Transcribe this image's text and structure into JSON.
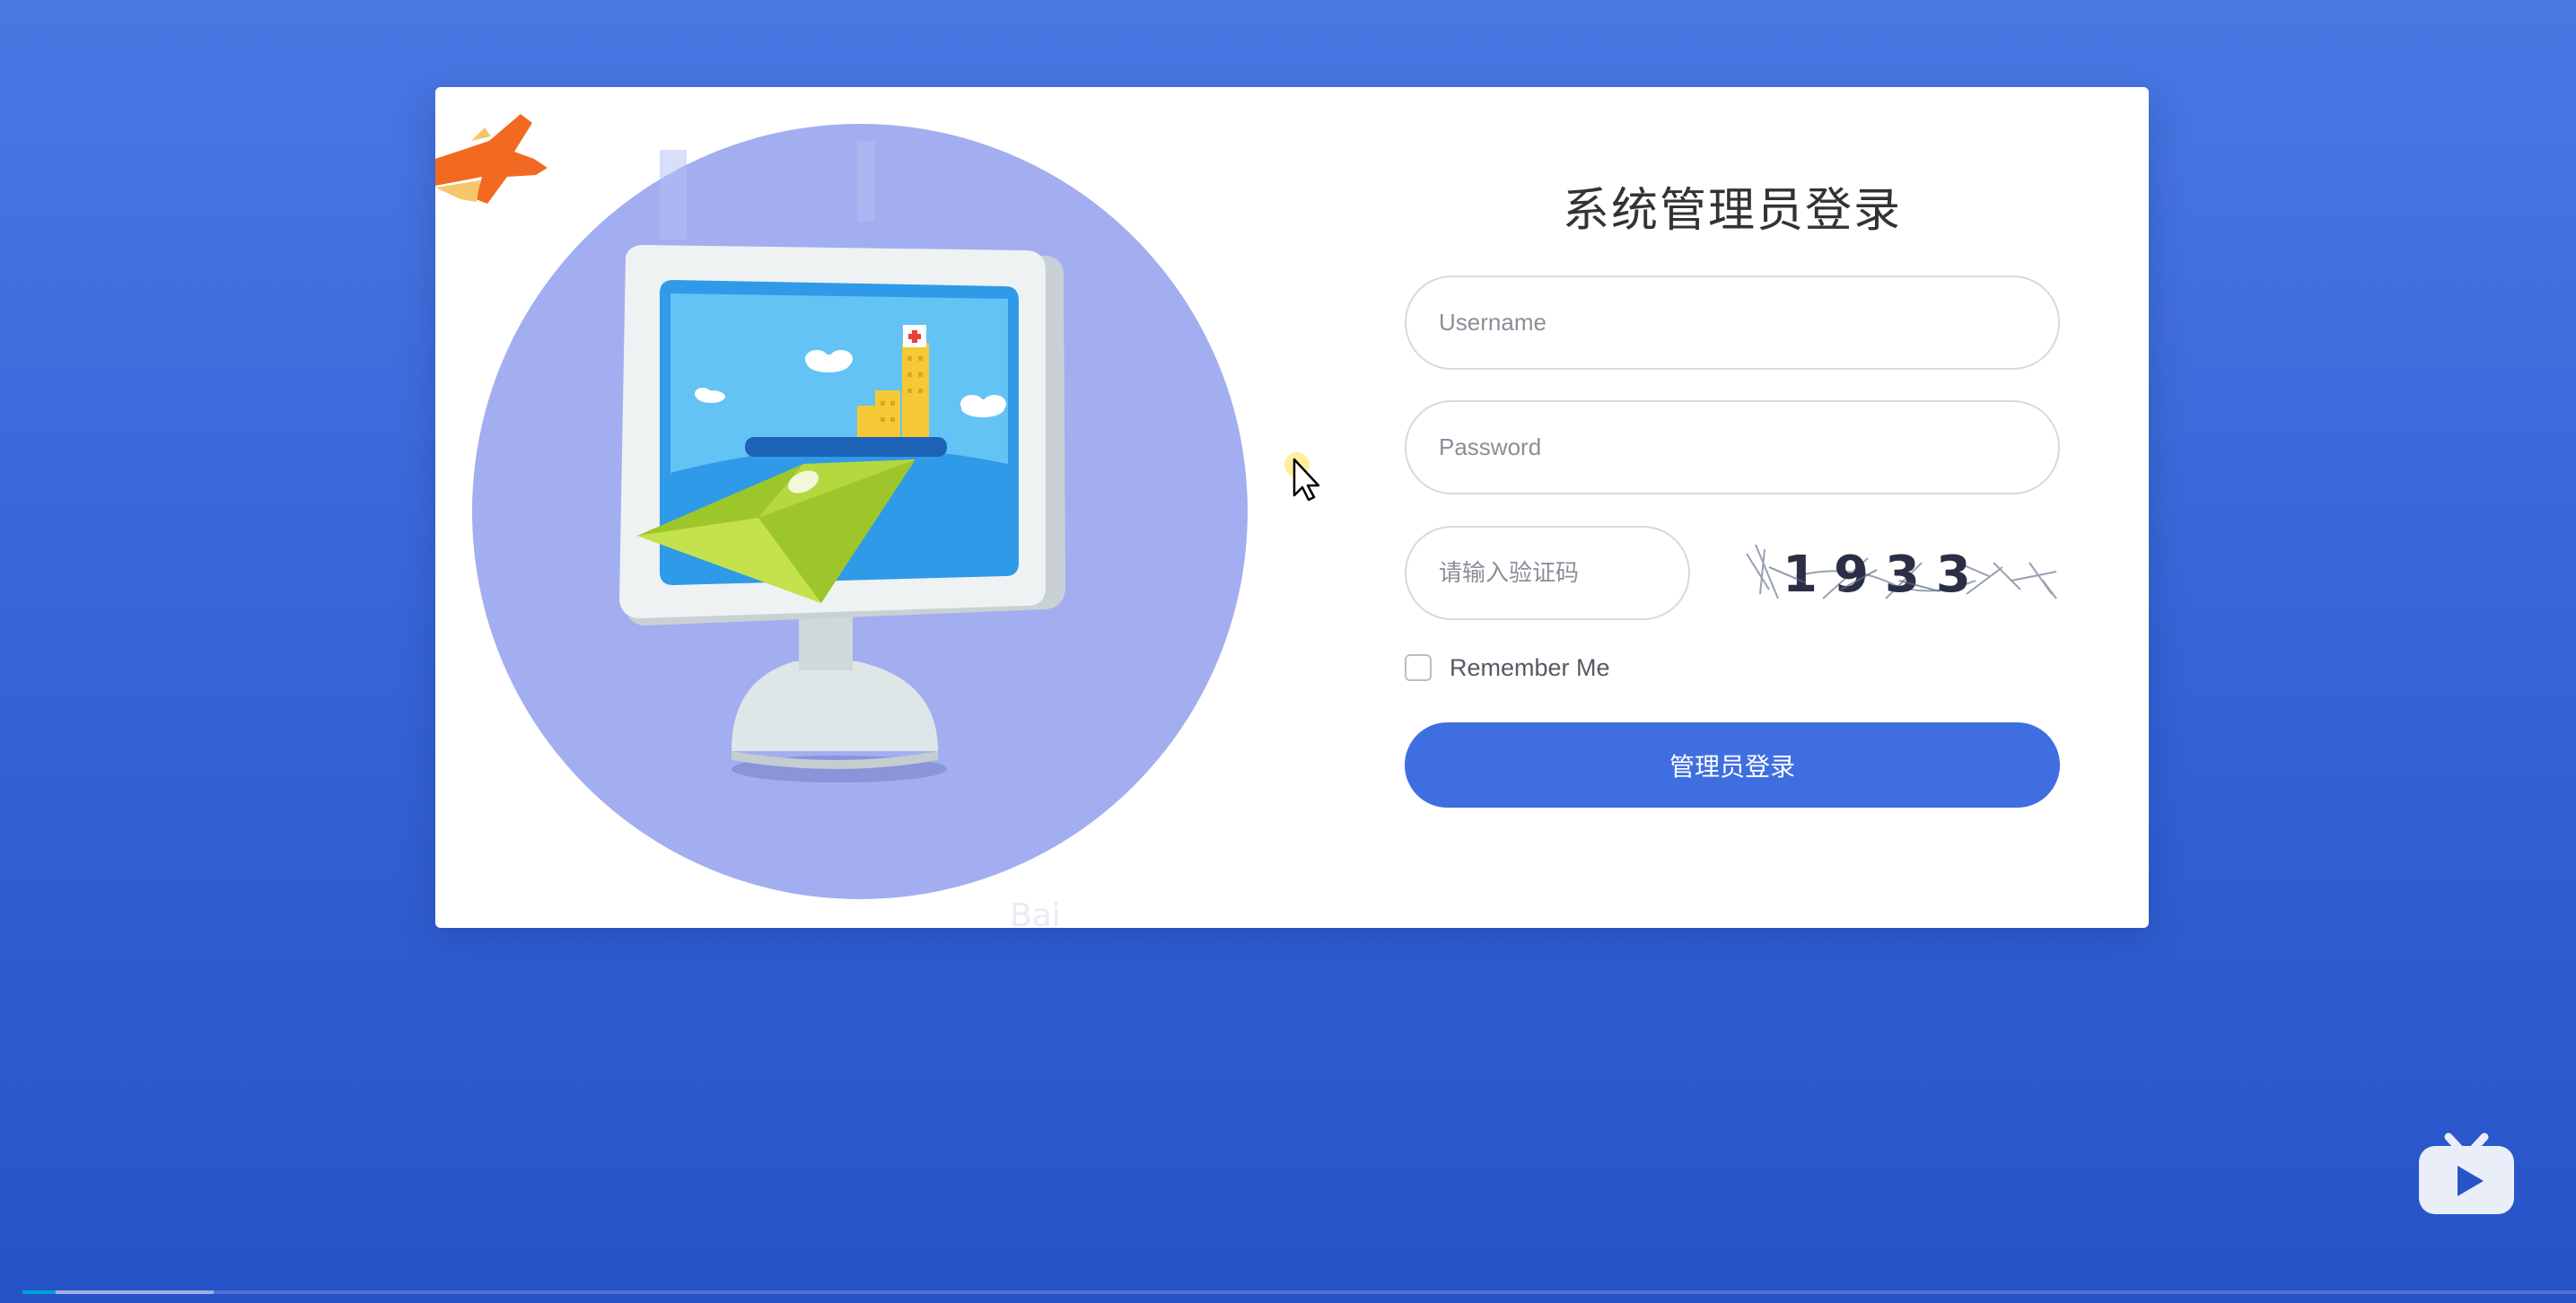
{
  "login": {
    "title": "系统管理员登录",
    "username_placeholder": "Username",
    "password_placeholder": "Password",
    "captcha_placeholder": "请输入验证码",
    "captcha_text": "1933",
    "remember_label": "Remember Me",
    "remember_checked": false,
    "submit_label": "管理员登录"
  },
  "video_player": {
    "logo_icon": "bilibili-tv-icon",
    "progress_fraction": 0.013,
    "buffered_fraction": 0.075
  },
  "colors": {
    "background_top": "#4a78e3",
    "background_bottom": "#2653c8",
    "button": "#3e6ee0",
    "illustration_circle": "#a2aef0",
    "progress": "#00a1d6"
  }
}
